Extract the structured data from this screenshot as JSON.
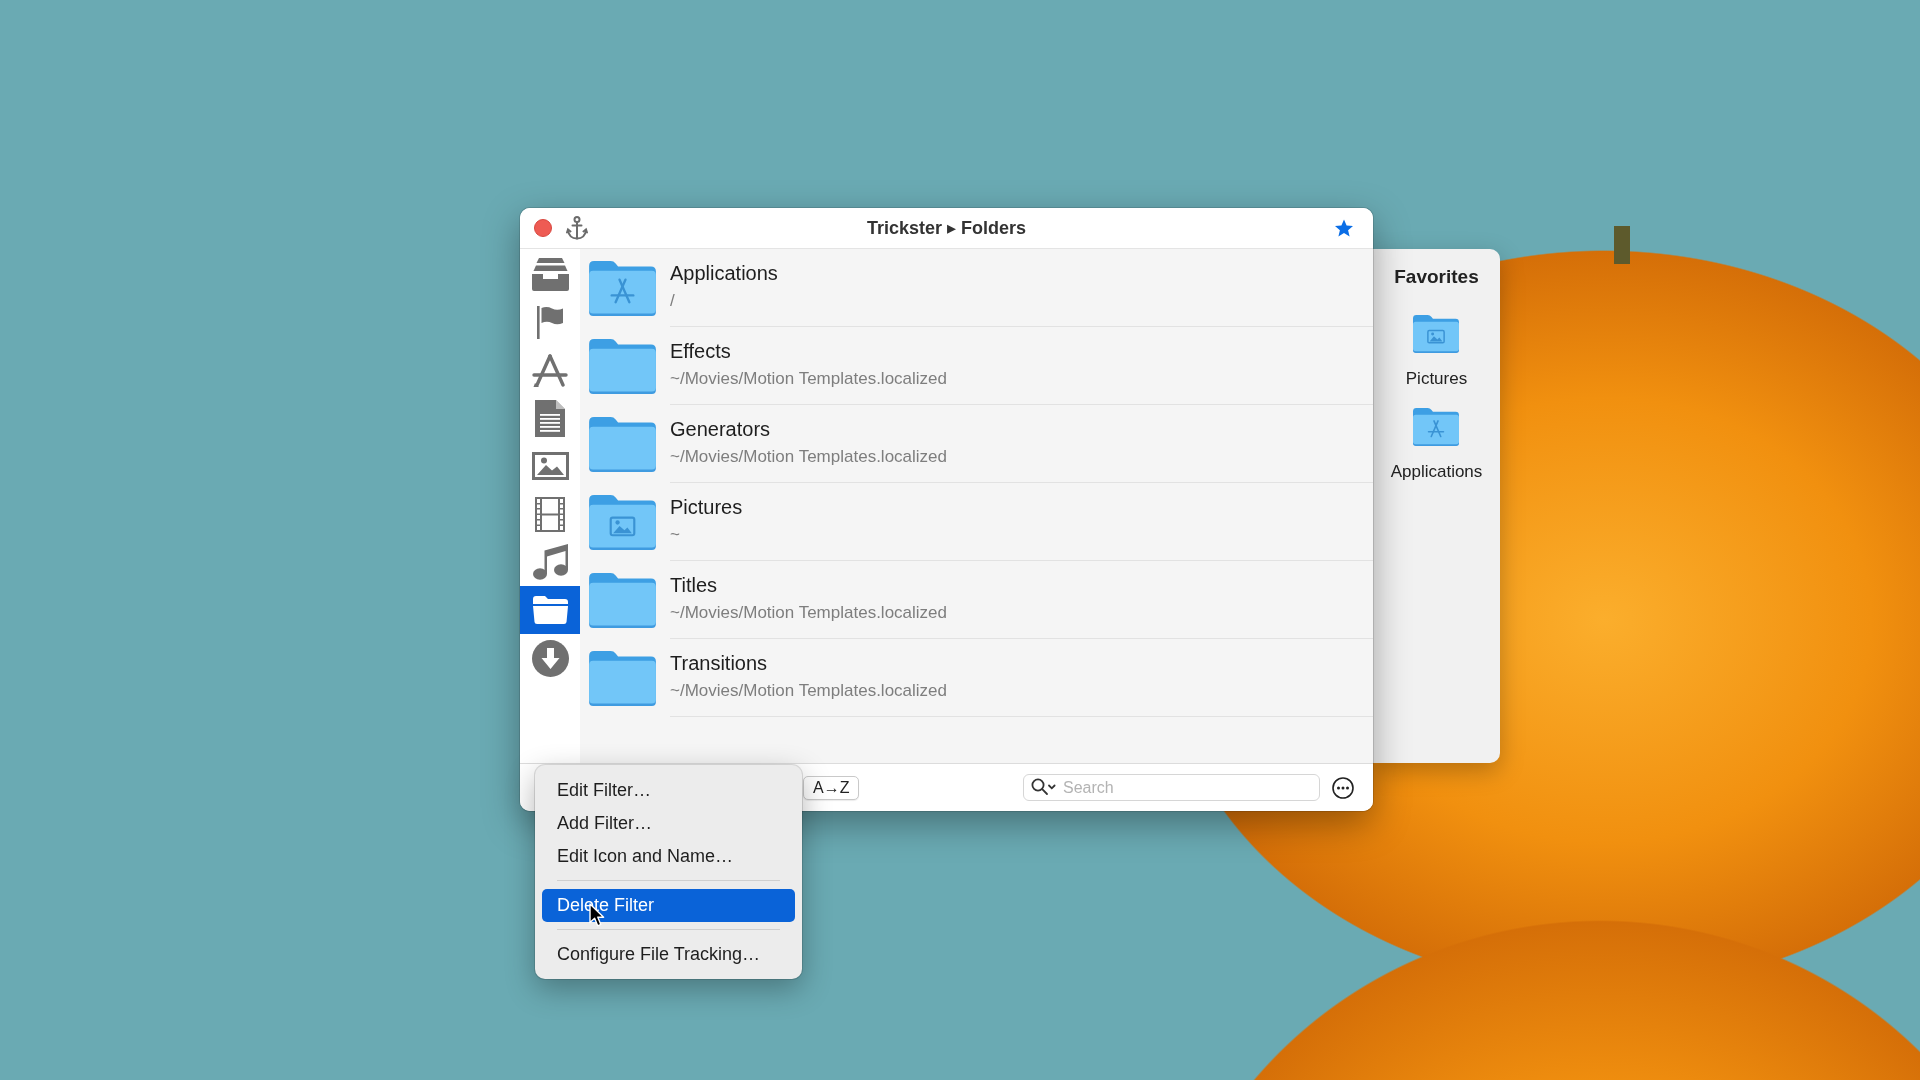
{
  "window": {
    "title": "Trickster ▸ Folders",
    "starred": true
  },
  "sidebar": {
    "items": [
      {
        "kind": "tray",
        "selected": false
      },
      {
        "kind": "flag",
        "selected": false
      },
      {
        "kind": "pencil-ruler",
        "selected": false
      },
      {
        "kind": "document",
        "selected": false
      },
      {
        "kind": "image",
        "selected": false
      },
      {
        "kind": "film",
        "selected": false
      },
      {
        "kind": "music",
        "selected": false
      },
      {
        "kind": "folder",
        "selected": true
      },
      {
        "kind": "download",
        "selected": false
      }
    ]
  },
  "folders": {
    "rows": [
      {
        "kind": "applications",
        "name": "Applications",
        "path": "/",
        "selected": false
      },
      {
        "kind": "plain",
        "name": "Effects",
        "path": "~/Movies/Motion Templates.localized",
        "selected": false
      },
      {
        "kind": "plain",
        "name": "Generators",
        "path": "~/Movies/Motion Templates.localized",
        "selected": false
      },
      {
        "kind": "pictures",
        "name": "Pictures",
        "path": "~",
        "selected": false
      },
      {
        "kind": "plain",
        "name": "Titles",
        "path": "~/Movies/Motion Templates.localized",
        "selected": false
      },
      {
        "kind": "plain",
        "name": "Transitions",
        "path": "~/Movies/Motion Templates.localized",
        "selected": false
      }
    ]
  },
  "toolbar": {
    "sort_button": "A→Z",
    "search": {
      "placeholder": "Search"
    }
  },
  "favorites": {
    "title": "Favorites",
    "items": [
      {
        "kind": "pictures",
        "label": "Pictures"
      },
      {
        "kind": "applications",
        "label": "Applications"
      }
    ]
  },
  "context_menu": {
    "sections": [
      {
        "items": [
          {
            "label": "Edit Filter…",
            "selected": false
          },
          {
            "label": "Add Filter…",
            "selected": false
          },
          {
            "label": "Edit Icon and Name…",
            "selected": false
          }
        ]
      },
      {
        "items": [
          {
            "label": "Delete Filter",
            "selected": true
          }
        ]
      },
      {
        "items": [
          {
            "label": "Configure File Tracking…",
            "selected": false
          }
        ]
      }
    ]
  }
}
